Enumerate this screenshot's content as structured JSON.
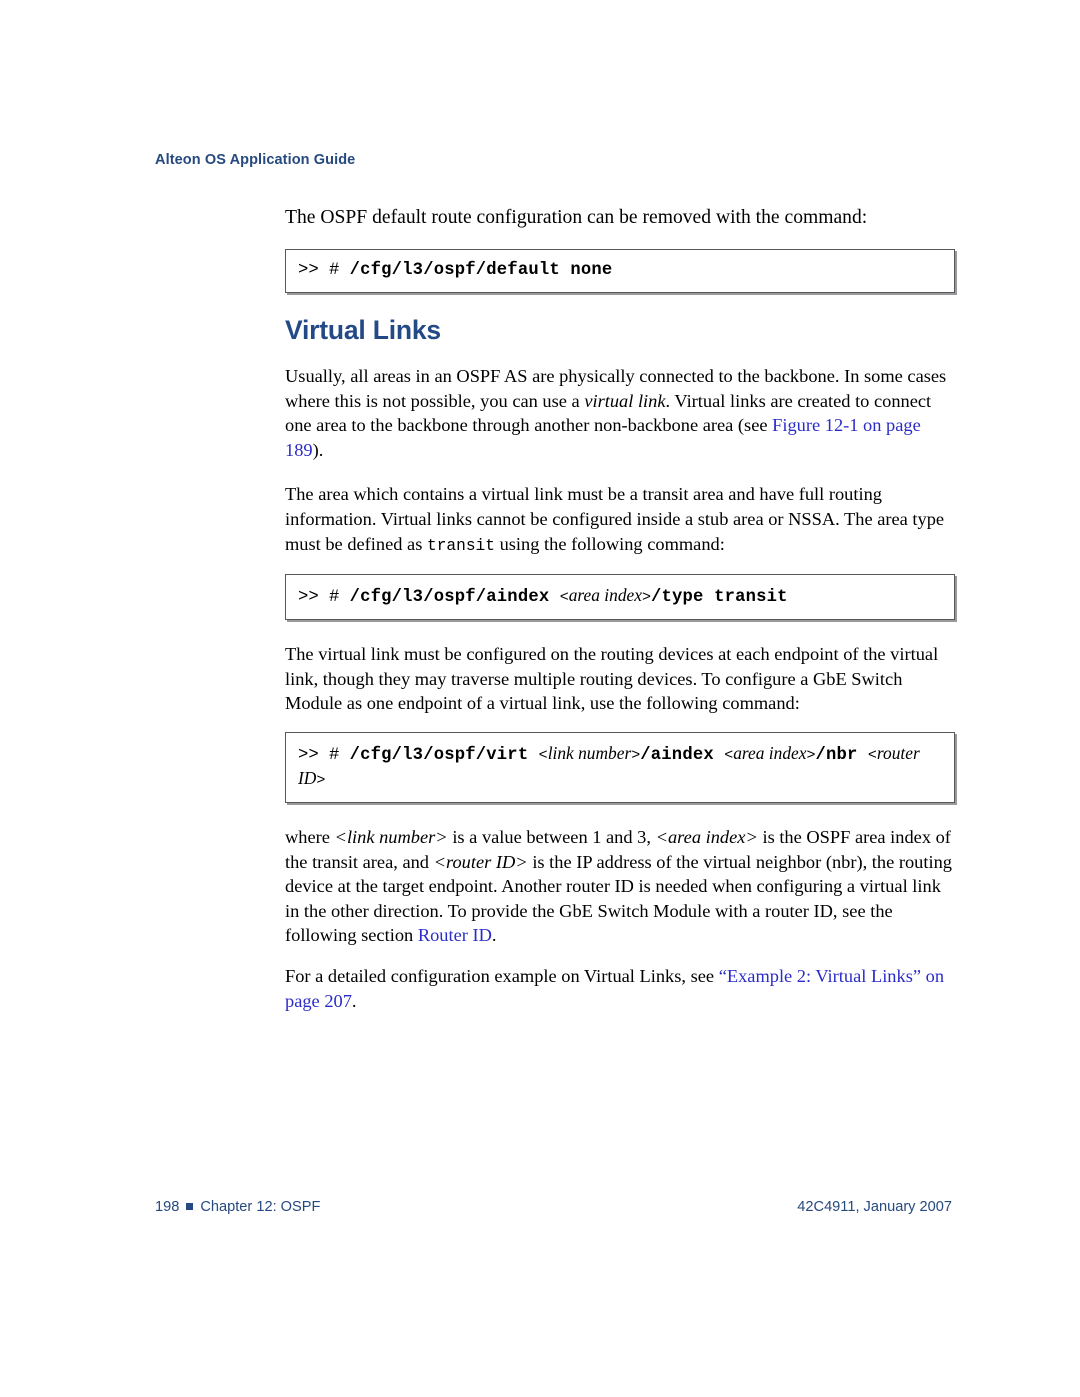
{
  "header": {
    "running_title": "Alteon OS Application Guide"
  },
  "intro": {
    "text": "The OSPF default route configuration can be removed with the command:"
  },
  "commands": {
    "default_none": {
      "prompt": ">> #",
      "command": "/cfg/l3/ospf/default none"
    },
    "aindex_type_transit": {
      "prompt": ">> #",
      "part1": "/cfg/l3/ospf/aindex",
      "var1_open": "<",
      "var1": "area index",
      "var1_close": ">",
      "part2": "/type transit"
    },
    "virt": {
      "prompt": ">> #",
      "part1": "/cfg/l3/ospf/virt",
      "var1_open": "<",
      "var1": "link number",
      "var1_close": ">",
      "part2": "/aindex",
      "var2_open": "<",
      "var2": "area index",
      "var2_close": ">",
      "part3": "/nbr",
      "var3_open": "<",
      "var3": "router ID",
      "var3_close": ">"
    }
  },
  "section": {
    "heading": "Virtual Links",
    "p1": {
      "a": "Usually, all areas in an OSPF AS are physically connected to the backbone. In some cases where this is not possible, you can use a ",
      "italic": "virtual link",
      "b": ". Virtual links are created to connect one area to the backbone through another non-backbone area (see ",
      "link": "Figure 12-1 on page 189",
      "c": ")."
    },
    "p2": {
      "a": "The area which contains a virtual link must be a transit area and have full routing information. Virtual links cannot be configured inside a stub area or NSSA. The area type must be defined as ",
      "mono": "transit",
      "b": " using the following command:"
    },
    "p3": {
      "text": "The virtual link must be configured on the routing devices at each endpoint of the virtual link, though they may traverse multiple routing devices. To configure a GbE Switch Module as one endpoint of a virtual link, use the following command:"
    },
    "p4": {
      "a": "where ",
      "var1": "<link number>",
      "b": " is a value between 1 and 3, ",
      "var2": "<area index>",
      "c": " is the OSPF area index of the transit area, and ",
      "var3": "<router ID>",
      "d": " is the IP address of the virtual neighbor (nbr), the routing device at the target endpoint. Another router ID is needed when configuring a virtual link in the other direction. To provide the GbE Switch Module with a router ID, see the following section ",
      "link": "Router ID",
      "e": "."
    },
    "p5": {
      "a": "For a detailed configuration example on Virtual Links, see ",
      "link": "“Example 2: Virtual Links” on page 207",
      "b": "."
    }
  },
  "footer": {
    "page_number": "198",
    "chapter": "Chapter 12:  OSPF",
    "doc_id": "42C4911, January 2007"
  },
  "colors": {
    "heading_blue": "#234a86",
    "link_blue": "#2b2bc9",
    "header_blue": "#26497f",
    "box_border": "#58585a"
  }
}
